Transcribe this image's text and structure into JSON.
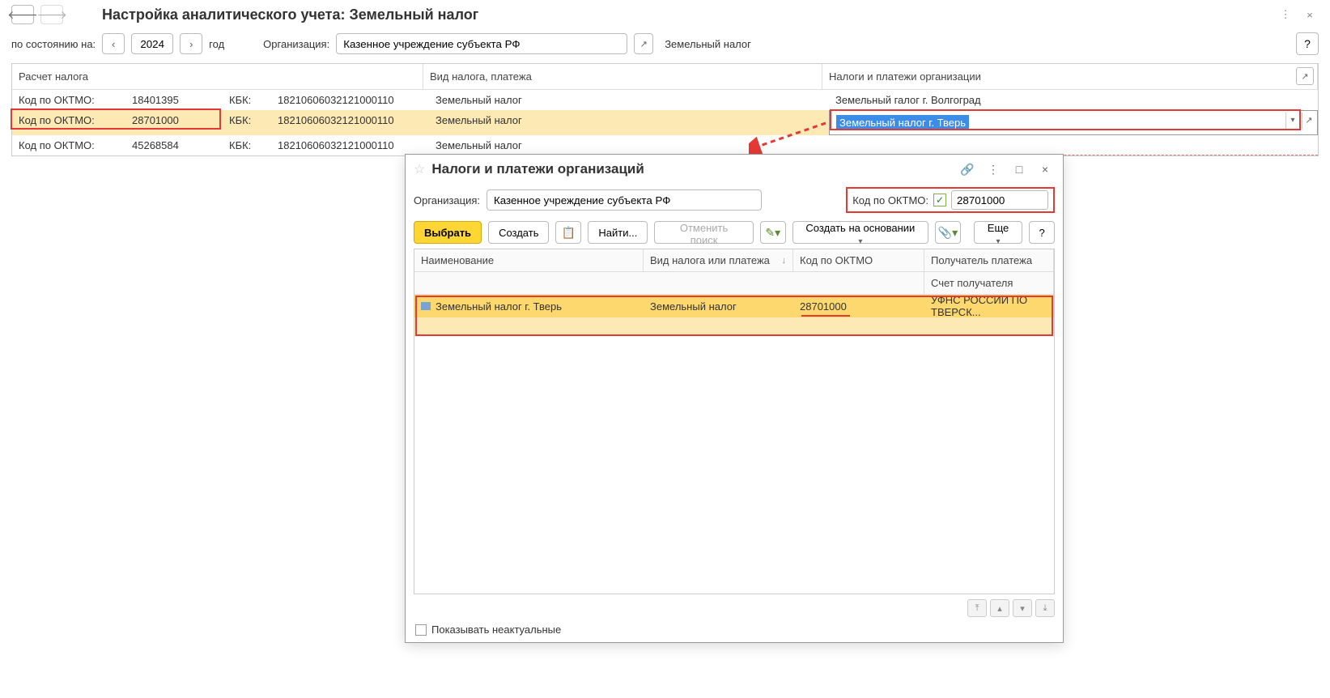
{
  "header": {
    "title": "Настройка аналитического учета: Земельный налог"
  },
  "filter": {
    "date_label": "по состоянию на:",
    "year": "2024",
    "year_unit": "год",
    "org_label": "Организация:",
    "org_value": "Казенное учреждение субъекта РФ",
    "tax_type": "Земельный налог",
    "help": "?"
  },
  "table": {
    "columns": {
      "calc": "Расчет налога",
      "kind": "Вид налога, платежа",
      "tax": "Налоги и платежи организации"
    },
    "rows": [
      {
        "oktmo_label": "Код по ОКТМО:",
        "oktmo": "18401395",
        "kbk_label": "КБК:",
        "kbk": "18210606032121000110",
        "kind": "Земельный налог",
        "tax": "Земельный галог г. Волгоград"
      },
      {
        "oktmo_label": "Код по ОКТМО:",
        "oktmo": "28701000",
        "kbk_label": "КБК:",
        "kbk": "18210606032121000110",
        "kind": "Земельный налог",
        "tax": "Земельный налог г. Тверь"
      },
      {
        "oktmo_label": "Код по ОКТМО:",
        "oktmo": "45268584",
        "kbk_label": "КБК:",
        "kbk": "18210606032121000110",
        "kind": "Земельный налог",
        "tax": ""
      }
    ]
  },
  "modal": {
    "title": "Налоги и платежи организаций",
    "org_label": "Организация:",
    "org_value": "Казенное учреждение субъекта РФ",
    "oktmo_label": "Код по ОКТМО:",
    "oktmo_value": "28701000",
    "toolbar": {
      "select": "Выбрать",
      "create": "Создать",
      "find": "Найти...",
      "cancel_search": "Отменить поиск",
      "create_based": "Создать на основании",
      "more": "Еще",
      "help": "?"
    },
    "columns": {
      "name": "Наименование",
      "kind": "Вид налога или платежа",
      "oktmo": "Код по ОКТМО",
      "recipient": "Получатель платежа",
      "account": "Счет получателя"
    },
    "rows": [
      {
        "name": "Земельный налог г. Тверь",
        "kind": "Земельный налог",
        "oktmo": "28701000",
        "recipient": "УФНС РОССИИ ПО ТВЕРСК..."
      }
    ],
    "footer": {
      "show_inactive": "Показывать неактуальные"
    }
  }
}
